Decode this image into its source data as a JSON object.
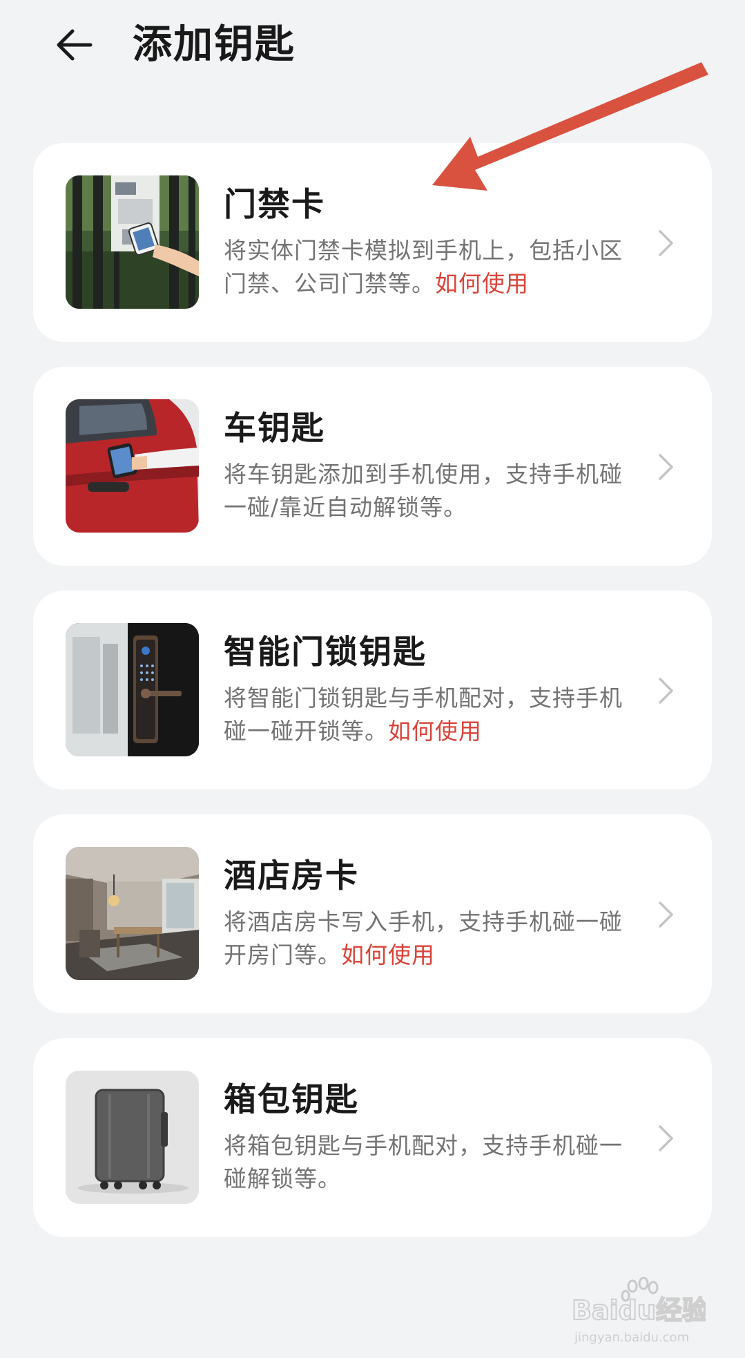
{
  "header": {
    "title": "添加钥匙",
    "back_icon": "arrow-left-icon"
  },
  "keys": [
    {
      "title": "门禁卡",
      "desc": "将实体门禁卡模拟到手机上，包括小区门禁、公司门禁等。",
      "link": "如何使用",
      "thumb_icon": "access-card-image"
    },
    {
      "title": "车钥匙",
      "desc": "将车钥匙添加到手机使用，支持手机碰一碰/靠近自动解锁等。",
      "link": "",
      "thumb_icon": "car-image"
    },
    {
      "title": "智能门锁钥匙",
      "desc": "将智能门锁钥匙与手机配对，支持手机碰一碰开锁等。",
      "link": "如何使用",
      "thumb_icon": "smart-lock-image"
    },
    {
      "title": "酒店房卡",
      "desc": "将酒店房卡写入手机，支持手机碰一碰开房门等。",
      "link": "如何使用",
      "thumb_icon": "hotel-room-image"
    },
    {
      "title": "箱包钥匙",
      "desc": "将箱包钥匙与手机配对，支持手机碰一碰解锁等。",
      "link": "",
      "thumb_icon": "suitcase-image"
    }
  ],
  "watermark": {
    "brand": "Baidu经验",
    "url": "jingyan.baidu.com"
  },
  "colors": {
    "background": "#f1f3f5",
    "card": "#ffffff",
    "link": "#d9443a",
    "annotation_arrow": "#d9523f"
  }
}
